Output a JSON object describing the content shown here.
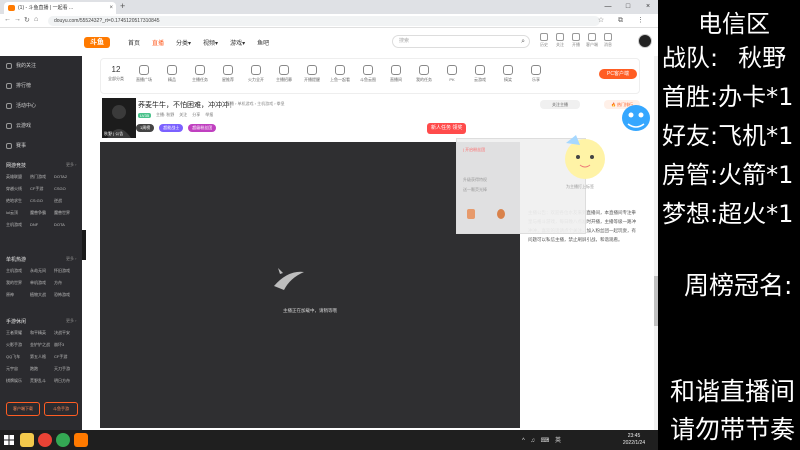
{
  "browser": {
    "tab_title": "(1) - 斗鱼直播 | 一起看 ...",
    "tab_close": "×",
    "new_tab": "+",
    "url": "douyu.com/5552432?_rt=0.1745120517310845",
    "window_buttons": [
      "—",
      "□",
      "×"
    ],
    "nav_icons": [
      "←",
      "→",
      "↻",
      "⌂"
    ],
    "right_icons": "☆ ⧉ ⋮"
  },
  "site": {
    "logo_text": "斗鱼",
    "nav": [
      "首页",
      "直播",
      "分类▾",
      "视频▾",
      "游戏▾",
      "鱼吧"
    ],
    "active_nav_index": 1,
    "search_placeholder": "搜索",
    "search_icon": "magnifier-icon",
    "header_icons": [
      "历史",
      "关注",
      "开播",
      "客户端",
      "消息"
    ]
  },
  "sidebar": {
    "top_items": [
      "我的关注",
      "排行榜",
      "活动中心",
      "云游戏",
      "赛事"
    ],
    "sections": [
      {
        "title": "网游竞技",
        "more": "更多 ›",
        "items": [
          "英雄联盟",
          "热门游戏",
          "DOTA2",
          "穿越火线",
          "CF手游",
          "CSGO",
          "绝地求生",
          "CS:GO",
          "逆战",
          "lol云顶",
          "魔兽争霸",
          "魔兽世界",
          "主机游戏",
          "DNF",
          "DOTA"
        ]
      },
      {
        "title": "单机热游",
        "more": "更多 ›",
        "items": [
          "主机游戏",
          "永劫无间",
          "怀旧游戏",
          "我的世界",
          "单机游戏",
          "方舟",
          "原神",
          "植物大战",
          "恐怖游戏"
        ]
      },
      {
        "title": "手游休闲",
        "more": "更多 ›",
        "items": [
          "王者荣耀",
          "和平精英",
          "决战平安",
          "火影手游",
          "金铲铲之战",
          "崩坏3",
          "QQ飞车",
          "第五人格",
          "CF手游",
          "元宇宙",
          "跑跑",
          "天刀手游",
          "棋牌娱乐",
          "荒野乱斗",
          "明日方舟"
        ]
      }
    ],
    "buttons": [
      "客户端下载",
      "斗鱼手游"
    ]
  },
  "categories": {
    "first_num": "12",
    "items": [
      "全部分类",
      "直播广场",
      "精品",
      "主播任务",
      "星推荐",
      "火力全开",
      "主播招募",
      "开播提醒",
      "上鱼一起看",
      "斗鱼云图",
      "直播间",
      "我的任务",
      "PK",
      "云游戏",
      "搞笑",
      "乐享"
    ],
    "pp_chip": "PC客户端"
  },
  "room": {
    "anchor_name": "秋野 | 公告",
    "title": "荞麦牛牛，不怕困难，冲冲冲！",
    "crumb": "直播 › 单机游戏 › 主机游戏 › 拳皇",
    "level": "LV35",
    "meta": [
      "主播: 秋野",
      "关注",
      "分享",
      "举报"
    ],
    "tags": [
      {
        "label": "1周榜",
        "color": "#444444"
      },
      {
        "label": "超能战士",
        "color": "#7b61ff"
      },
      {
        "label": "超级粉丝团",
        "color": "#c040c0"
      }
    ],
    "newbie_button": "新人任务 领奖"
  },
  "player": {
    "loading_text": "主播正在加载中，请稍等哦"
  },
  "right_panel": {
    "follow_label": "关注主播",
    "hot_label": "🔥 热门排行",
    "popup_lines": [
      "| 开启粉丝团",
      "升级获得特权",
      "送一颗荧光棒"
    ],
    "mascot_caption": "为主播打上标签",
    "announcement": "主播公告：欢迎各位水友来到直播间，本直播间专注拳皇与格斗游戏，每日晚八点准时开播，主播等级一路冲冲冲，喜欢的话请点个关注，加入粉丝团一起玩耍，有问题可以私信主播，禁止刷屏引战，和谐观看。"
  },
  "taskbar": {
    "clock_time": "23:45",
    "clock_date": "2022/1/24",
    "tray": "^ ♫ ⌨ 英"
  },
  "overlay": {
    "title": "电信区",
    "lines": [
      {
        "k": "战队:",
        "v": "秋野"
      },
      {
        "k": "首胜:",
        "v": "办卡*1"
      },
      {
        "k": "好友:",
        "v": "飞机*1"
      },
      {
        "k": "房管:",
        "v": "火箭*1"
      },
      {
        "k": "梦想:",
        "v": "超火*1"
      }
    ],
    "weekly_title": "周榜冠名:",
    "footer1": "和谐直播间",
    "footer2": "请勿带节奏"
  },
  "colors": {
    "accent": "#ff5d23",
    "sidebar_bg": "#2b2b2f",
    "player_bg": "#2f2f31"
  }
}
